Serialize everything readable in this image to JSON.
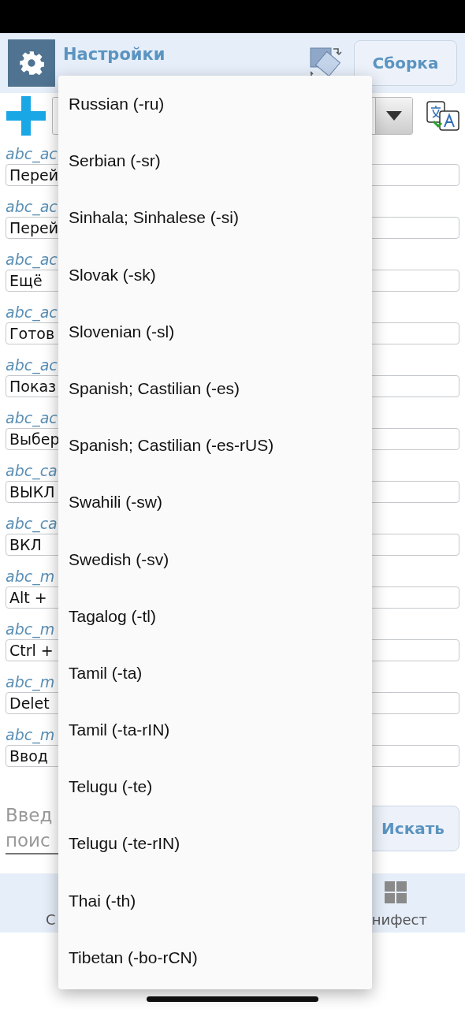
{
  "header": {
    "title": "Настройки",
    "build_button": "Сборка"
  },
  "rows": [
    {
      "label": "abc_ac",
      "value": "Перей"
    },
    {
      "label": "abc_ac",
      "value": "Перей"
    },
    {
      "label": "abc_ac",
      "value": "Ещё"
    },
    {
      "label": "abc_ac",
      "value": "Готов"
    },
    {
      "label": "abc_ac",
      "value": "Показ"
    },
    {
      "label": "abc_ac",
      "value": "Выбер"
    },
    {
      "label": "abc_ca",
      "value": "ВЫКЛ"
    },
    {
      "label": "abc_ca",
      "value": "ВКЛ"
    },
    {
      "label": "abc_m",
      "value": "Alt +"
    },
    {
      "label": "abc_m",
      "value": "Ctrl +"
    },
    {
      "label": "abc_m",
      "value": "Delet"
    },
    {
      "label": "abc_m",
      "value": "Ввод"
    }
  ],
  "search": {
    "placeholder_lines": [
      "Введ",
      "поис"
    ],
    "button": "Искать"
  },
  "bottom_nav": [
    {
      "label": "С",
      "kind": "plain"
    },
    {
      "label": "нифест",
      "kind": "grid"
    }
  ],
  "language_menu": [
    "Russian (-ru)",
    "Serbian (-sr)",
    "Sinhala; Sinhalese (-si)",
    "Slovak (-sk)",
    "Slovenian (-sl)",
    "Spanish; Castilian (-es)",
    "Spanish; Castilian (-es-rUS)",
    "Swahili (-sw)",
    "Swedish (-sv)",
    "Tagalog (-tl)",
    "Tamil (-ta)",
    "Tamil (-ta-rIN)",
    "Telugu (-te)",
    "Telugu (-te-rIN)",
    "Thai (-th)",
    "Tibetan (-bo-rCN)"
  ]
}
